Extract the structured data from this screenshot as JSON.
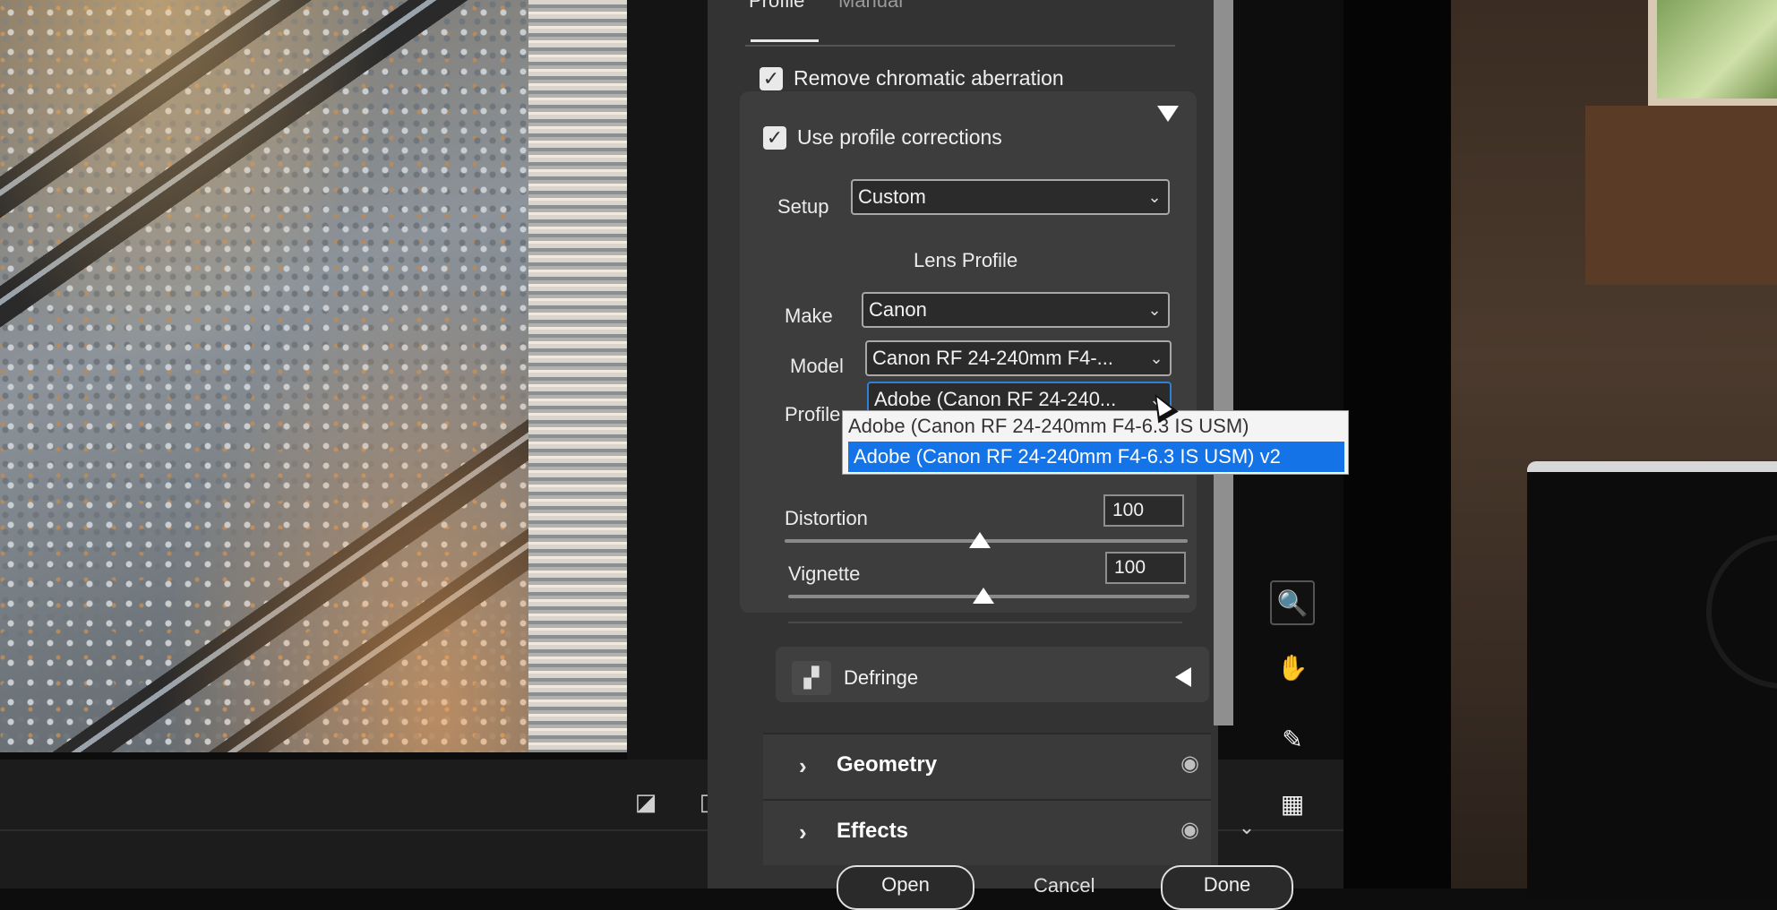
{
  "tabs": {
    "profile": "Profile",
    "manual": "Manual"
  },
  "remove_ca": {
    "label": "Remove chromatic aberration",
    "checked": true
  },
  "use_profile": {
    "label": "Use profile corrections",
    "checked": true
  },
  "setup": {
    "label": "Setup",
    "value": "Custom"
  },
  "lens_profile": {
    "title": "Lens Profile",
    "make": {
      "label": "Make",
      "value": "Canon"
    },
    "model": {
      "label": "Model",
      "value": "Canon RF 24-240mm F4-..."
    },
    "profile": {
      "label": "Profile",
      "value": "Adobe (Canon RF 24-240..."
    }
  },
  "profile_menu": {
    "options": [
      "Adobe (Canon RF 24-240mm F4-6.3 IS USM)",
      "Adobe (Canon RF 24-240mm F4-6.3 IS USM) v2"
    ],
    "selected_index": 1
  },
  "distortion": {
    "label": "Distortion",
    "value": "100"
  },
  "vignette": {
    "label": "Vignette",
    "value": "100"
  },
  "defringe": {
    "label": "Defringe"
  },
  "groups": {
    "geometry": "Geometry",
    "effects": "Effects"
  },
  "footer": {
    "open": "Open",
    "cancel": "Cancel",
    "done": "Done"
  },
  "check_glyph": "✓",
  "accent_color": "#1473e6"
}
